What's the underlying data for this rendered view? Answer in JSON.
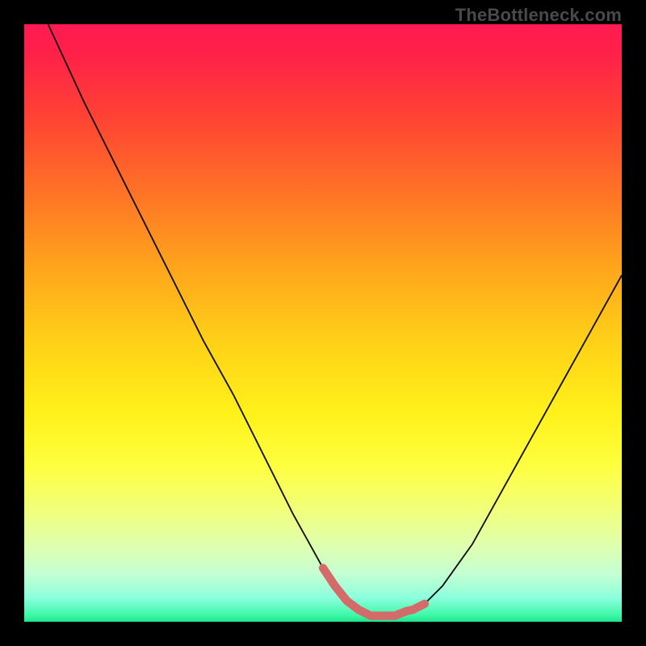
{
  "attribution": "TheBottleneck.com",
  "colors": {
    "background": "#000000",
    "curve": "#111111",
    "highlight": "#d46a6a",
    "gradient_top": "#ff1a52",
    "gradient_bottom": "#1ee28b"
  },
  "chart_data": {
    "type": "line",
    "title": "",
    "xlabel": "",
    "ylabel": "",
    "xlim": [
      0,
      100
    ],
    "ylim": [
      0,
      100
    ],
    "annotations": [],
    "series": [
      {
        "name": "bottleneck-curve",
        "x": [
          4,
          10,
          15,
          20,
          25,
          30,
          35,
          40,
          45,
          50,
          53,
          56,
          58,
          60,
          62,
          65,
          67,
          70,
          75,
          80,
          85,
          90,
          95,
          100
        ],
        "y": [
          100,
          87,
          77,
          67,
          57,
          47,
          38,
          28,
          18,
          9,
          4,
          2,
          1,
          1,
          1,
          2,
          3,
          6,
          13,
          22,
          31,
          40,
          49,
          58
        ]
      },
      {
        "name": "sweet-spot-highlight",
        "x": [
          50,
          52,
          54,
          56,
          58,
          60,
          62,
          64,
          65,
          66,
          67
        ],
        "y": [
          9,
          6,
          3.5,
          2,
          1,
          1,
          1,
          1.8,
          2,
          2.5,
          3
        ]
      }
    ]
  }
}
